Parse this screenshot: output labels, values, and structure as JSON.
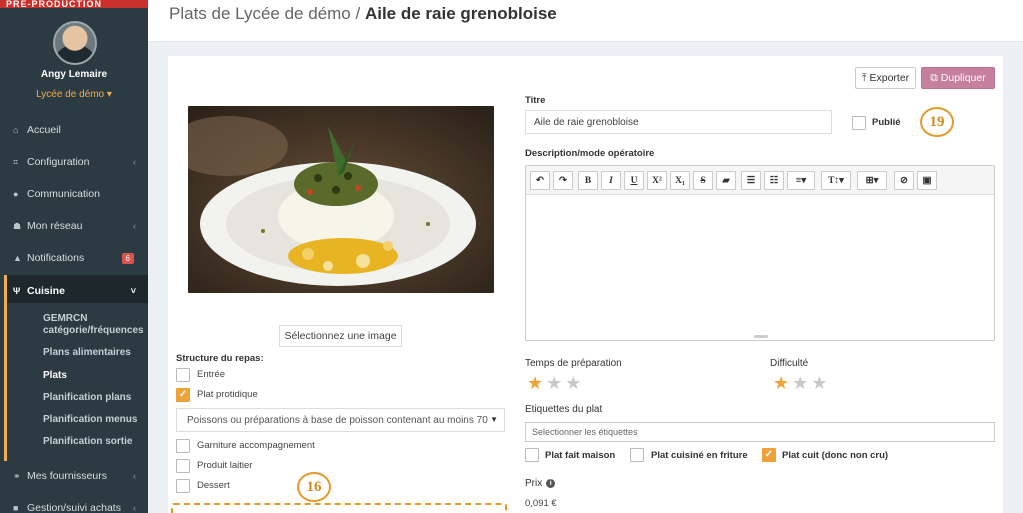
{
  "sidebar": {
    "banner": "PRÉ-PRODUCTION",
    "user_name": "Angy Lemaire",
    "school": "Lycée de démo ▾",
    "items": [
      {
        "icon": "home-icon",
        "glyph": "⌂",
        "label": "Accueil"
      },
      {
        "icon": "bank-icon",
        "glyph": "⌗",
        "label": "Configuration",
        "chevron": "‹"
      },
      {
        "icon": "comments-icon",
        "glyph": "●",
        "label": "Communication"
      },
      {
        "icon": "users-icon",
        "glyph": "☗",
        "label": "Mon réseau",
        "chevron": "‹"
      },
      {
        "icon": "bell-icon",
        "glyph": "▲",
        "label": "Notifications",
        "badge": "6"
      },
      {
        "icon": "cutlery-icon",
        "glyph": "Ψ",
        "label": "Cuisine",
        "chevron": "˅"
      },
      {
        "icon": "handshake-icon",
        "glyph": "⚭",
        "label": "Mes fournisseurs",
        "chevron": "‹"
      },
      {
        "icon": "cart-icon",
        "glyph": "■",
        "label": "Gestion/suivi achats",
        "chevron": "‹"
      }
    ],
    "submenu": [
      "GEMRCN catégorie/fréquences",
      "Plans alimentaires",
      "Plats",
      "Planification plans",
      "Planification menus",
      "Planification sortie"
    ]
  },
  "header": {
    "breadcrumb_prefix": "Plats de Lycée de démo /",
    "dish_name": "Aile de raie grenobloise"
  },
  "actions": {
    "export_label": "Exporter",
    "duplicate_label": "Dupliquer"
  },
  "image": {
    "select_label": "Sélectionnez une image"
  },
  "structure": {
    "label": "Structure du repas:",
    "options": [
      {
        "label": "Entrée",
        "checked": false
      },
      {
        "label": "Plat protidique",
        "checked": true
      },
      {
        "label": "Garniture accompagnement",
        "checked": false
      },
      {
        "label": "Produit laitier",
        "checked": false
      },
      {
        "label": "Dessert",
        "checked": false
      }
    ],
    "protein_select": "Poissons ou préparations à base de poisson contenant au moins 70"
  },
  "form": {
    "title_label": "Titre",
    "title_value": "Aile de raie grenobloise",
    "published_label": "Publié",
    "published": false,
    "description_label": "Description/mode opératoire",
    "prep_time_label": "Temps de préparation",
    "prep_time_rating": 1,
    "difficulty_label": "Difficulté",
    "difficulty_rating": 1,
    "tags_label": "Etiquettes du plat",
    "tags_placeholder": "Selectionner les étiquettes",
    "flags": [
      {
        "label": "Plat fait maison",
        "checked": false
      },
      {
        "label": "Plat cuisiné en friture",
        "checked": false
      },
      {
        "label": "Plat cuit (donc non cru)",
        "checked": true
      }
    ],
    "price_label": "Prix",
    "price_value": "0,091 €"
  },
  "toolbar": [
    "↶",
    "↷",
    "B",
    "I",
    "U",
    "X²",
    "X₁",
    "S",
    "▰",
    "☰",
    "☷",
    "≡▾",
    "T↕▾",
    "⊞▾",
    "⊘",
    "▣"
  ],
  "annotations": {
    "a19": "19",
    "a16": "16"
  },
  "colors": {
    "accent": "#f0a23a",
    "duplicate": "#c77fa0",
    "sidebar": "#2c3b41"
  }
}
